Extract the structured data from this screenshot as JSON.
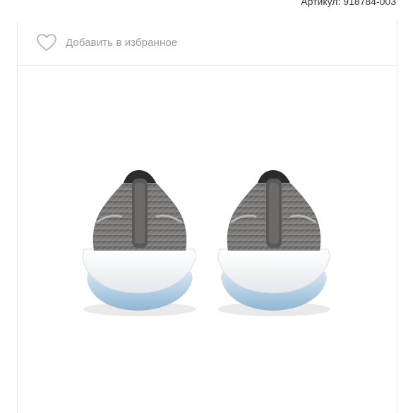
{
  "header": {
    "sku_text": "Артикул: 918784-003"
  },
  "favorite": {
    "label": "Добавить в избранное",
    "icon": "heart-outline-icon"
  },
  "product_image": {
    "description_colors": {
      "upper": "#6e6c6b",
      "sole": "#f4f5f7",
      "outsole": "#a9c7dc"
    }
  }
}
